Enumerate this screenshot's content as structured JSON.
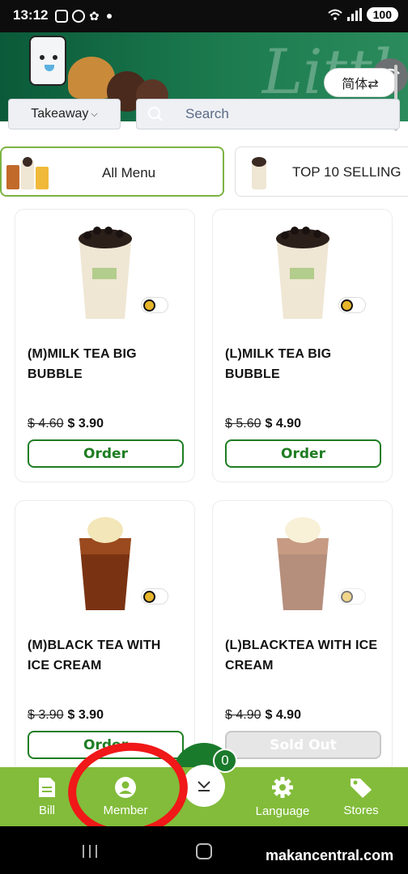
{
  "status_bar": {
    "time": "13:12",
    "battery": "100"
  },
  "header": {
    "language_button": "简体⇄"
  },
  "mode_select": {
    "value": "Takeaway"
  },
  "search": {
    "placeholder": "Search"
  },
  "categories": [
    {
      "label": "All Menu",
      "selected": true
    },
    {
      "label": "TOP 10 SELLING",
      "selected": false
    }
  ],
  "products": [
    {
      "name": "(M)MILK TEA BIG BUBBLE",
      "old_price": "$ 4.60",
      "price": "$ 3.90",
      "button": "Order",
      "available": true
    },
    {
      "name": "(L)MILK TEA BIG BUBBLE",
      "old_price": "$ 5.60",
      "price": "$ 4.90",
      "button": "Order",
      "available": true
    },
    {
      "name": "(M)BLACK TEA WITH ICE CREAM",
      "old_price": "$ 3.90",
      "price": "$ 3.90",
      "button": "Order",
      "available": true
    },
    {
      "name": "(L)BLACKTEA WITH ICE CREAM",
      "old_price": "$ 4.90",
      "price": "$ 4.90",
      "button": "Sold Out",
      "available": false
    }
  ],
  "cart": {
    "count": "0"
  },
  "bottom_nav": [
    {
      "label": "Bill",
      "icon": "bill-icon"
    },
    {
      "label": "Member",
      "icon": "member-icon"
    },
    {
      "label": "Language",
      "icon": "gear-icon"
    },
    {
      "label": "Stores",
      "icon": "tag-icon"
    }
  ],
  "watermark": "makancentral.com",
  "colors": {
    "brand_green": "#1e7d22",
    "nav_green": "#82bc3a",
    "annotation_red": "#f01818"
  }
}
